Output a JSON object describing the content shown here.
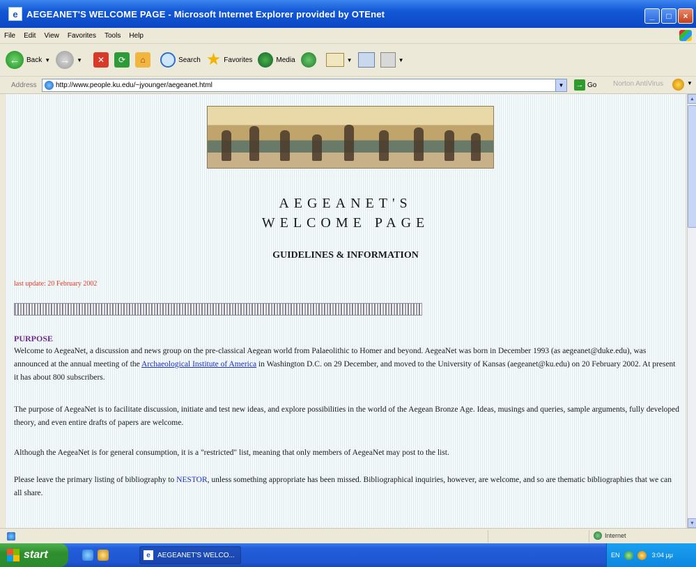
{
  "window": {
    "title": "AEGEANET'S WELCOME PAGE - Microsoft Internet Explorer provided by OTEnet"
  },
  "menubar": {
    "items": [
      "File",
      "Edit",
      "View",
      "Favorites",
      "Tools",
      "Help"
    ]
  },
  "toolbar": {
    "back_label": "Back",
    "search_label": "Search",
    "favorites_label": "Favorites",
    "media_label": "Media"
  },
  "addressbar": {
    "label": "Address",
    "url": "http://www.people.ku.edu/~jyounger/aegeanet.html",
    "go_label": "Go",
    "norton_label": "Norton AntiVirus"
  },
  "page": {
    "title_line1": "AEGEANET'S",
    "title_line2": "WELCOME PAGE",
    "subtitle": "GUIDELINES & INFORMATION",
    "last_update": "last update: 20 February 2002",
    "purpose_heading": "PURPOSE",
    "p1_before_link": "Welcome to AegeaNet, a discussion and news group on the pre-classical Aegean world from Palaeolithic to Homer and beyond. AegeaNet was born in December 1993 (as aegeanet@duke.edu), was announced at the annual meeting of the ",
    "p1_link": "Archaeological Institute of America",
    "p1_after_link": " in Washington D.C. on 29 December, and moved to the University of Kansas (aegeanet@ku.edu) on 20 February 2002. At present it has about 800 subscribers.",
    "p2": "The purpose of AegeaNet is to facilitate discussion, initiate and test new ideas, and explore possibilities in the world of the Aegean Bronze Age. Ideas, musings and queries, sample arguments, fully developed theory, and even entire drafts of papers are welcome.",
    "p3": "Although the AegeaNet is for general consumption, it is a \"restricted\" list, meaning that only members of AegeaNet may post to the list.",
    "p4_before": "Please leave the primary listing of bibliography to ",
    "p4_link": "NESTOR",
    "p4_after": ", unless something appropriate has been missed. Bibliographical inquiries, however, are welcome, and so are thematic bibliographies that we can all share."
  },
  "statusbar": {
    "zone": "Internet"
  },
  "taskbar": {
    "start_label": "start",
    "task_label": "AEGEANET'S WELCO...",
    "lang": "EN",
    "time": "3:04 μμ"
  },
  "colors": {
    "titlebar": "#0b47c4",
    "last_update": "#e23a2a",
    "purpose": "#6b2c8c",
    "link": "#1a2fbf"
  }
}
